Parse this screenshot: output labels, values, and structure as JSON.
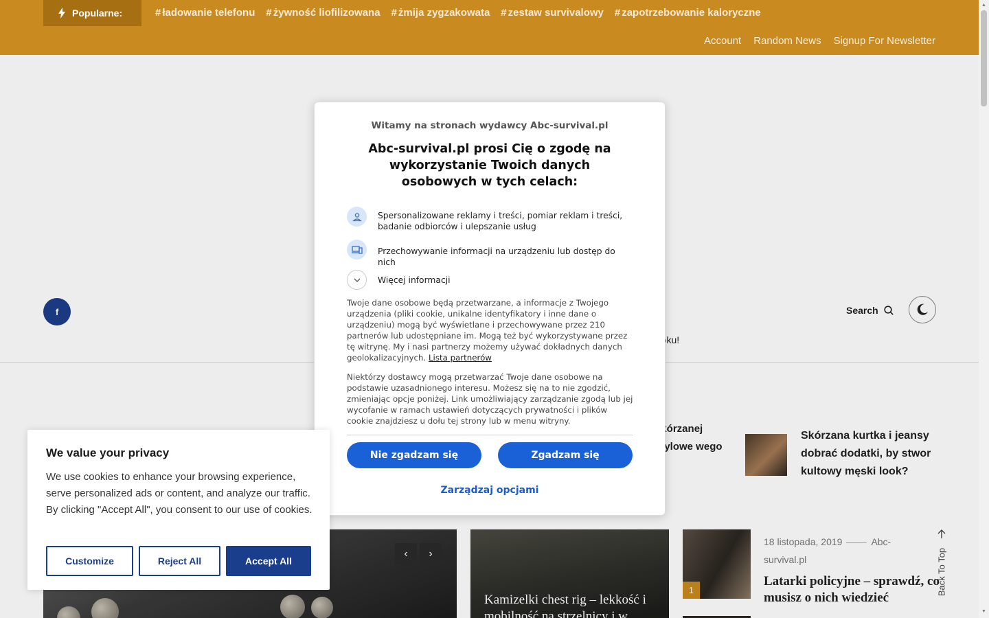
{
  "topbar": {
    "popular_label": "Popularne:",
    "tags": [
      "ładowanie telefonu",
      "żywność liofilizowana",
      "żmija zygzakowata",
      "zestaw survivalowy",
      "zapotrzebowanie kaloryczne"
    ],
    "nav": [
      "Account",
      "Random News",
      "Signup For Newsletter"
    ]
  },
  "header": {
    "social_fb": "f",
    "search_label": "Search",
    "ticker_tail": "roku!"
  },
  "posts": {
    "mini1": "skórzanej stylowe wego",
    "mini2": "Skórzana kurtka i jeansy dobrać dodatki, by stwor kultowy męski look?",
    "feature_title": "Kamizelki chest rig – lekkość i mobilność na strzelnicy i w",
    "side_meta_date": "18 listopada, 2019",
    "side_meta_author": "Abc-survival.pl",
    "side_title": "Latarki policyjne – sprawdź, co musisz o nich wiedzieć",
    "side_num": "1",
    "back_to_top": "Back To Top"
  },
  "modal": {
    "pretitle": "Witamy na stronach wydawcy Abc-survival.pl",
    "title": "Abc-survival.pl prosi Cię o zgodę na wykorzystanie Twoich danych osobowych w tych celach:",
    "purpose1": "Spersonalizowane reklamy i treści, pomiar reklam i treści, badanie odbiorców i ulepszanie usług",
    "purpose2": "Przechowywanie informacji na urządzeniu lub dostęp do nich",
    "more": "Więcej informacji",
    "par1": "Twoje dane osobowe będą przetwarzane, a informacje z Twojego urządzenia (pliki cookie, unikalne identyfikatory i inne dane o urządzeniu) mogą być wyświetlane i przechowywane przez 210 partnerów lub udostępniane im. Mogą też być wykorzystywane przez tę witrynę. My i nasi partnerzy możemy używać dokładnych danych geolokalizacyjnych.",
    "partners_link": "Lista partnerów",
    "par2": "Niektórzy dostawcy mogą przetwarzać Twoje dane osobowe na podstawie uzasadnionego interesu. Możesz się na to nie zgodzić, zmieniając opcje poniżej. Link umożliwiający zarządzanie zgodą lub jej wycofanie w ramach ustawień dotyczących prywatności i plików cookie znajdziesz u dołu tej strony lub w menu witryny.",
    "reject": "Nie zgadzam się",
    "accept": "Zgadzam się",
    "manage": "Zarządzaj opcjami"
  },
  "cookie": {
    "title": "We value your privacy",
    "text": "We use cookies to enhance your browsing experience, serve personalized ads or content, and analyze our traffic. By clicking \"Accept All\", you consent to our use of cookies.",
    "customize": "Customize",
    "reject_all": "Reject All",
    "accept_all": "Accept All"
  },
  "colors": {
    "topbar": "#c98a1f",
    "consent_blue": "#1a60d6",
    "cookie_blue": "#1a3e8c"
  }
}
